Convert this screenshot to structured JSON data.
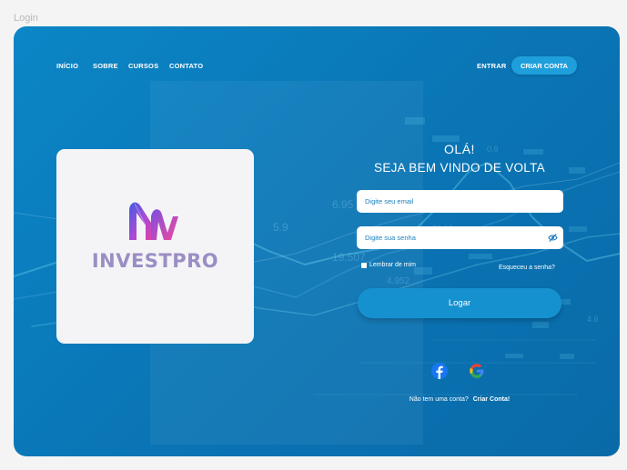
{
  "frame_label": "Login",
  "nav": {
    "links": [
      "INÍCIO",
      "SOBRE",
      "CURSOS",
      "CONTATO"
    ],
    "login": "ENTRAR",
    "signup": "CRIAR CONTA"
  },
  "brand": {
    "name": "INVESTPRO"
  },
  "form": {
    "greeting": "OLÁ!",
    "welcome": "SEJA BEM VINDO DE VOLTA",
    "email_placeholder": "Digite seu email",
    "password_placeholder": "Digite sua senha",
    "remember": "Lembrar de mim",
    "forgot": "Esqueceu a senha?",
    "submit": "Logar",
    "no_account": "Não tem uma conta?",
    "create": "Criar Conta!"
  },
  "colors": {
    "accent": "#0a78b8",
    "button": "#1691d0",
    "brand_text": "#9b8ec4"
  }
}
